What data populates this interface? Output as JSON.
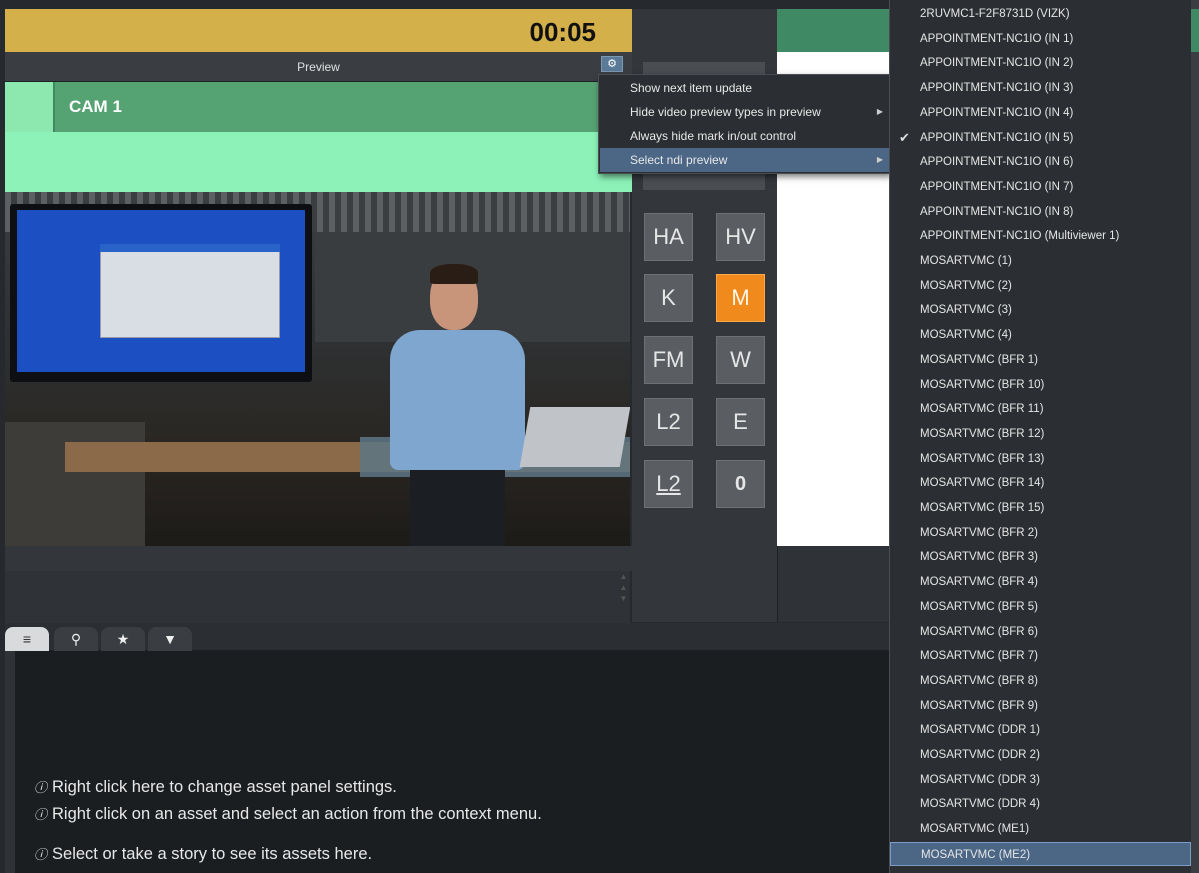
{
  "timer": "00:05",
  "preview": {
    "title": "Preview",
    "settings_icon": "gear-icon"
  },
  "cam": {
    "label": "CAM 1"
  },
  "context_menu": {
    "items": [
      {
        "label": "Show next item update"
      },
      {
        "label": "Hide video preview types in preview",
        "has_submenu": true
      },
      {
        "label": "Always hide mark in/out control"
      },
      {
        "label": "Select ndi preview",
        "has_submenu": true,
        "active": true
      }
    ]
  },
  "ndi_sources": {
    "items": [
      {
        "label": "2RUVMC1-F2F8731D (VIZK)"
      },
      {
        "label": "APPOINTMENT-NC1IO (IN 1)"
      },
      {
        "label": "APPOINTMENT-NC1IO (IN 2)"
      },
      {
        "label": "APPOINTMENT-NC1IO (IN 3)"
      },
      {
        "label": "APPOINTMENT-NC1IO (IN 4)"
      },
      {
        "label": "APPOINTMENT-NC1IO (IN 5)",
        "checked": true
      },
      {
        "label": "APPOINTMENT-NC1IO (IN 6)"
      },
      {
        "label": "APPOINTMENT-NC1IO (IN 7)"
      },
      {
        "label": "APPOINTMENT-NC1IO (IN 8)"
      },
      {
        "label": "APPOINTMENT-NC1IO (Multiviewer 1)"
      },
      {
        "label": "MOSARTVMC (1)"
      },
      {
        "label": "MOSARTVMC (2)"
      },
      {
        "label": "MOSARTVMC (3)"
      },
      {
        "label": "MOSARTVMC (4)"
      },
      {
        "label": "MOSARTVMC (BFR 1)"
      },
      {
        "label": "MOSARTVMC (BFR 10)"
      },
      {
        "label": "MOSARTVMC (BFR 11)"
      },
      {
        "label": "MOSARTVMC (BFR 12)"
      },
      {
        "label": "MOSARTVMC (BFR 13)"
      },
      {
        "label": "MOSARTVMC (BFR 14)"
      },
      {
        "label": "MOSARTVMC (BFR 15)"
      },
      {
        "label": "MOSARTVMC (BFR 2)"
      },
      {
        "label": "MOSARTVMC (BFR 3)"
      },
      {
        "label": "MOSARTVMC (BFR 4)"
      },
      {
        "label": "MOSARTVMC (BFR 5)"
      },
      {
        "label": "MOSARTVMC (BFR 6)"
      },
      {
        "label": "MOSARTVMC (BFR 7)"
      },
      {
        "label": "MOSARTVMC (BFR 8)"
      },
      {
        "label": "MOSARTVMC (BFR 9)"
      },
      {
        "label": "MOSARTVMC (DDR 1)"
      },
      {
        "label": "MOSARTVMC (DDR 2)"
      },
      {
        "label": "MOSARTVMC (DDR 3)"
      },
      {
        "label": "MOSARTVMC (DDR 4)"
      },
      {
        "label": "MOSARTVMC (ME1)"
      },
      {
        "label": "MOSARTVMC (ME2)",
        "hovered": true
      }
    ]
  },
  "buttons": [
    {
      "label": "HA"
    },
    {
      "label": "HV"
    },
    {
      "label": "K"
    },
    {
      "label": "M",
      "state": "active"
    },
    {
      "label": "FM"
    },
    {
      "label": "W"
    },
    {
      "label": "L2"
    },
    {
      "label": "E"
    },
    {
      "label": "L2",
      "style": "underline"
    },
    {
      "label": "0",
      "style": "bold"
    }
  ],
  "asset_tabs": [
    {
      "icon": "list-icon",
      "active": true
    },
    {
      "icon": "search-icon"
    },
    {
      "icon": "star-icon"
    },
    {
      "icon": "filter-icon"
    }
  ],
  "asset_hints": [
    "Right click here to change asset panel settings.",
    "Right click on an asset and select an action from the context menu.",
    "Select or take a story to see its assets here."
  ],
  "colors": {
    "timer_bg": "#d4b04a",
    "cam_green": "#55a272",
    "mint": "#8cf2b8",
    "active_orange": "#f08a1c",
    "menu_highlight": "#4c6686"
  }
}
